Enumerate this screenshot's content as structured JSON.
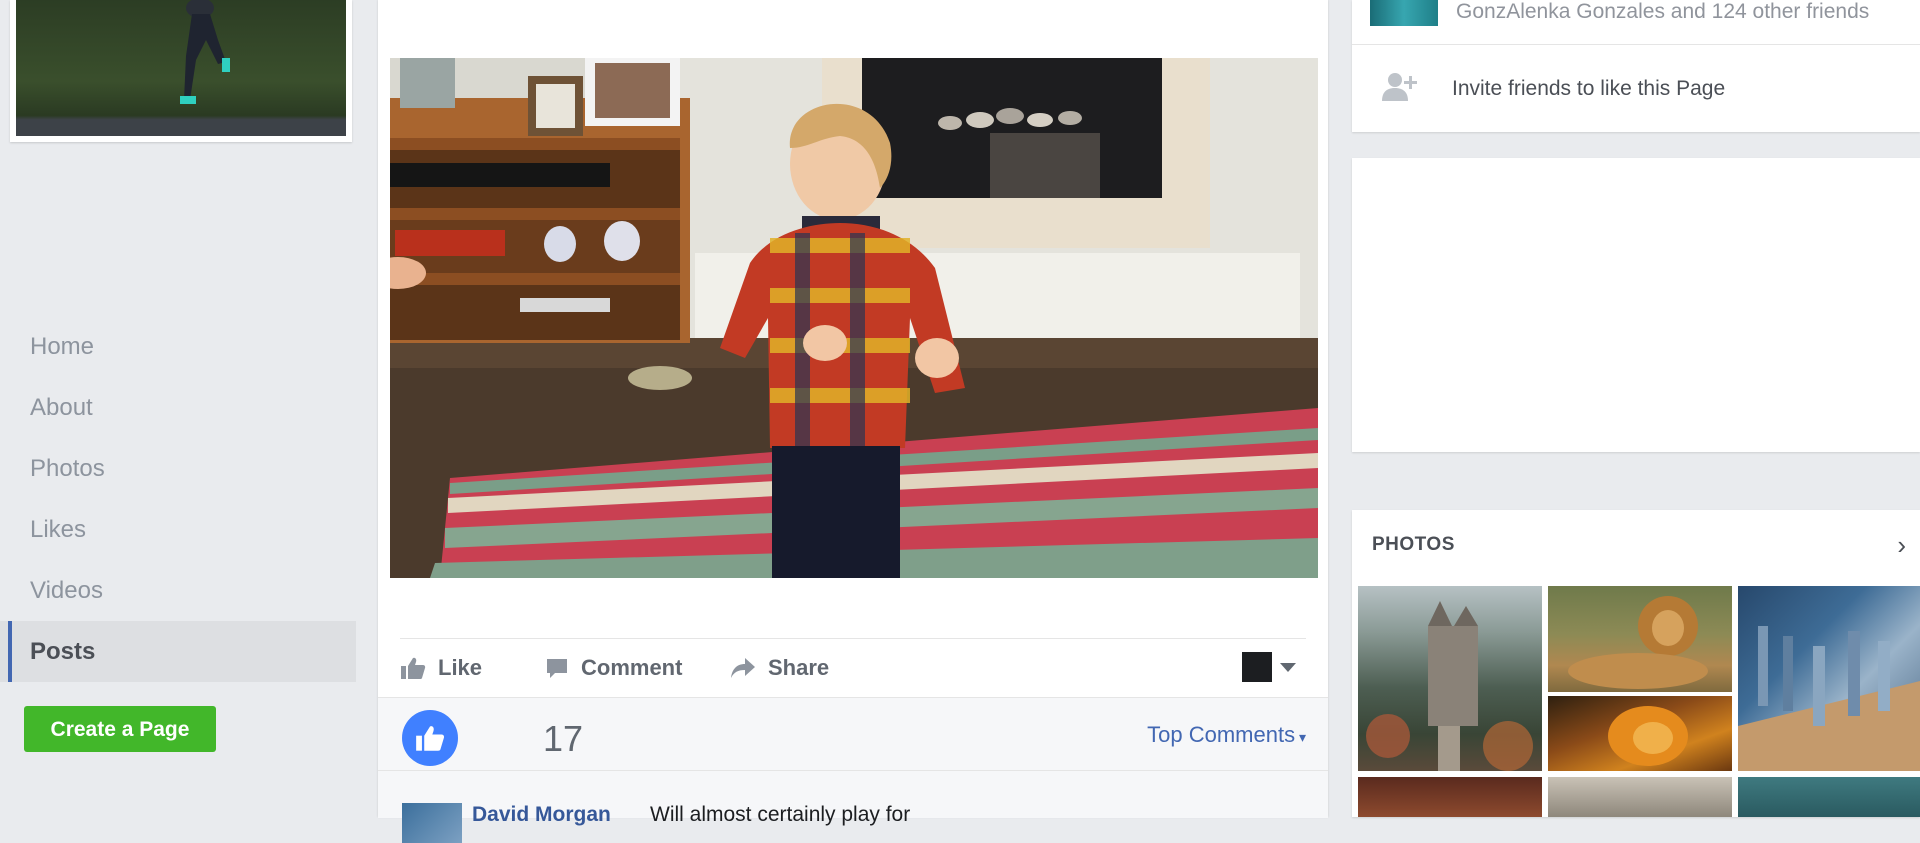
{
  "left_nav": {
    "items": [
      {
        "label": "Home",
        "active": false
      },
      {
        "label": "About",
        "active": false
      },
      {
        "label": "Photos",
        "active": false
      },
      {
        "label": "Likes",
        "active": false
      },
      {
        "label": "Videos",
        "active": false
      },
      {
        "label": "Posts",
        "active": true
      }
    ],
    "create_page_label": "Create a Page"
  },
  "post": {
    "actions": {
      "like": "Like",
      "comment": "Comment",
      "share": "Share"
    },
    "reactions": {
      "count": "17",
      "sort_label": "Top Comments"
    },
    "comment": {
      "author": "David Morgan",
      "text": "Will almost certainly play for"
    }
  },
  "right_col": {
    "friends_text": "GonzAlenka Gonzales and 124 other friends",
    "invite_label": "Invite friends to like this Page",
    "photos_title": "PHOTOS"
  },
  "icons": {
    "like": "thumbs-up-icon",
    "comment": "speech-bubble-icon",
    "share": "share-arrow-icon",
    "invite": "add-person-icon",
    "photos_more": "chevron-right-icon"
  },
  "colors": {
    "accent": "#4267b2",
    "like_blue": "#4080ff",
    "create_green": "#42b72a",
    "page_bg": "#e9ebee"
  }
}
